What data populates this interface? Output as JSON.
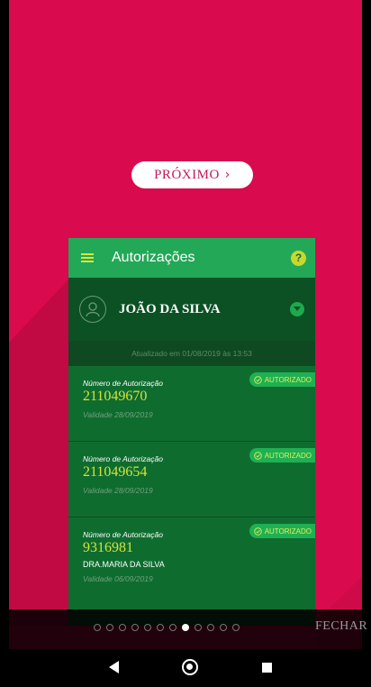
{
  "onboarding": {
    "next_label": "PRÓXIMO",
    "close_label": "FECHAR",
    "page_count": 12,
    "active_page": 8
  },
  "app": {
    "title": "Autorizações",
    "help_symbol": "?",
    "user_name": "JOÃO DA SILVA",
    "updated_text": "Atualizado em 01/08/2019 às 13:53",
    "authorizations": [
      {
        "label": "Número de Autorização",
        "number": "211049670",
        "validity": "Validade 28/09/2019",
        "status": "AUTORIZADO"
      },
      {
        "label": "Número de Autorização",
        "number": "211049654",
        "validity": "Validade 28/09/2019",
        "status": "AUTORIZADO"
      },
      {
        "label": "Número de Autorização",
        "number": "9316981",
        "doctor": "DRA.MARIA DA SILVA",
        "validity": "Validade 06/09/2019",
        "status": "AUTORIZADO"
      }
    ]
  },
  "colors": {
    "background": "#d90a4d",
    "app_bar": "#23a857",
    "accent": "#d3e43a"
  }
}
